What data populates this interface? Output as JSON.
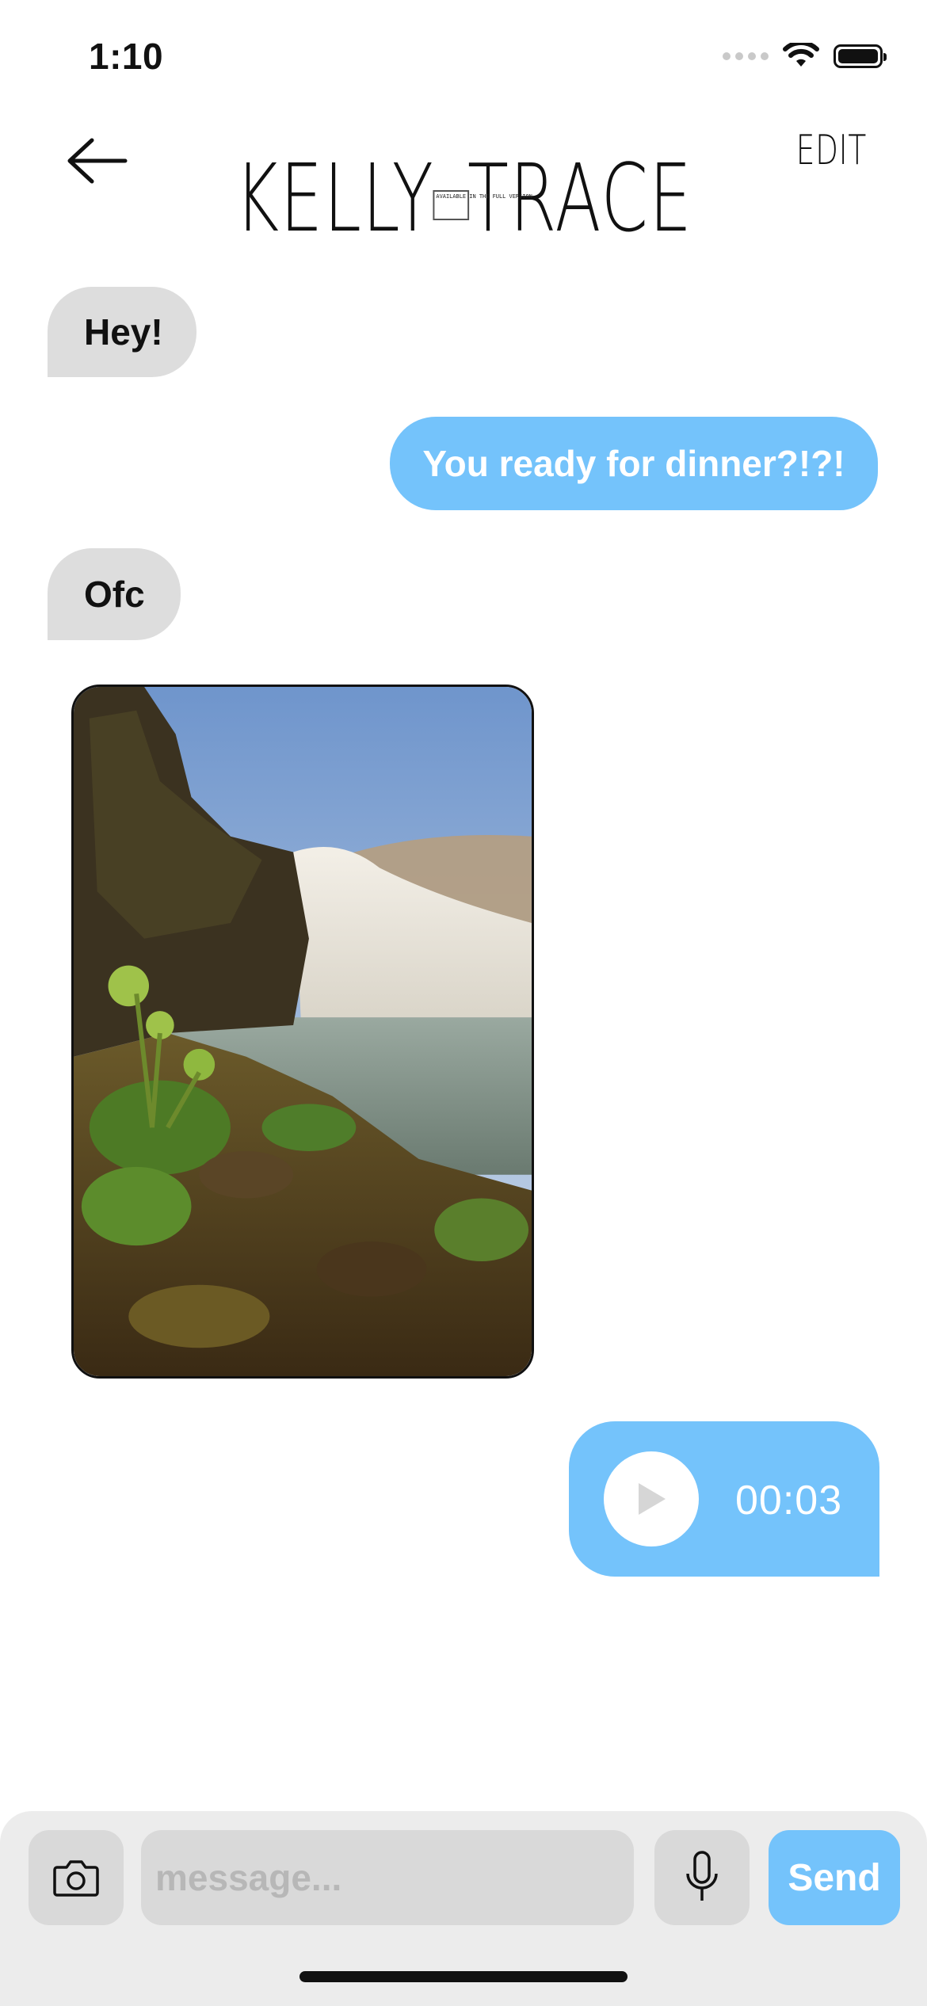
{
  "status_bar": {
    "time": "1:10",
    "icons": [
      "signal-dots-icon",
      "wifi-icon",
      "battery-icon"
    ]
  },
  "header": {
    "back_icon": "arrow-left-icon",
    "title_first": "KELLY",
    "title_last": "TRACE",
    "badge_text": "AVAILABLE IN THE FULL VERSION",
    "edit_label": "EDIT"
  },
  "messages": [
    {
      "direction": "received",
      "type": "text",
      "text": "Hey!"
    },
    {
      "direction": "sent",
      "type": "text",
      "text": "You ready for dinner?!?!"
    },
    {
      "direction": "received",
      "type": "text",
      "text": "Ofc"
    },
    {
      "direction": "received",
      "type": "image",
      "subject": "waterfall-photo"
    },
    {
      "direction": "sent",
      "type": "voice",
      "duration": "00:03",
      "icon": "play-icon"
    }
  ],
  "composer": {
    "camera_icon": "camera-icon",
    "placeholder": "message...",
    "value": "",
    "mic_icon": "microphone-icon",
    "send_label": "Send"
  },
  "colors": {
    "sent_bubble": "#74c3fb",
    "received_bubble": "#dddddd",
    "composer_bg": "#ececec",
    "input_bg": "#d9d9d9"
  }
}
